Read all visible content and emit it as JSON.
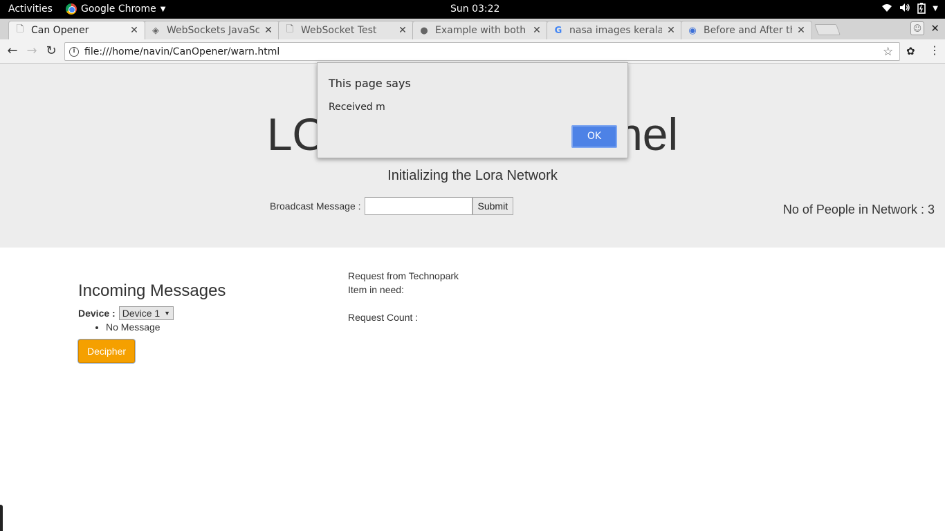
{
  "topbar": {
    "activities": "Activities",
    "app_name": "Google Chrome",
    "clock": "Sun 03:22",
    "tray_icons": [
      "wifi-icon",
      "volume-icon",
      "battery-icon",
      "power-caret-icon"
    ]
  },
  "tabs": [
    {
      "title": "Can Opener",
      "icon": "page-icon",
      "active": true
    },
    {
      "title": "WebSockets JavaSc",
      "icon": "websocket-site-icon",
      "active": false
    },
    {
      "title": "WebSocket Test",
      "icon": "page-icon",
      "active": false
    },
    {
      "title": "Example with both s",
      "icon": "github-icon",
      "active": false
    },
    {
      "title": "nasa images kerala",
      "icon": "google-icon",
      "active": false
    },
    {
      "title": "Before and After the",
      "icon": "site-icon",
      "active": false
    }
  ],
  "toolbar": {
    "url": "file:///home/navin/CanOpener/warn.html"
  },
  "page": {
    "heading": "LORA Control Panel",
    "subtitle": "Initializing the Lora Network",
    "broadcast_label": "Broadcast Message :",
    "broadcast_value": "",
    "submit_label": "Submit",
    "people_count": "No of People in Network : 3",
    "incoming_title": "Incoming Messages",
    "device_label": "Device :",
    "device_selected": "Device 1",
    "messages": [
      "No Message"
    ],
    "decipher_label": "Decipher",
    "request_from": "Request from Technopark",
    "item_in_need": "Item in need:",
    "request_count": "Request Count :"
  },
  "dialog": {
    "title": "This page says",
    "message": "Received m",
    "ok_label": "OK",
    "ok_color": "#4d82e6"
  }
}
